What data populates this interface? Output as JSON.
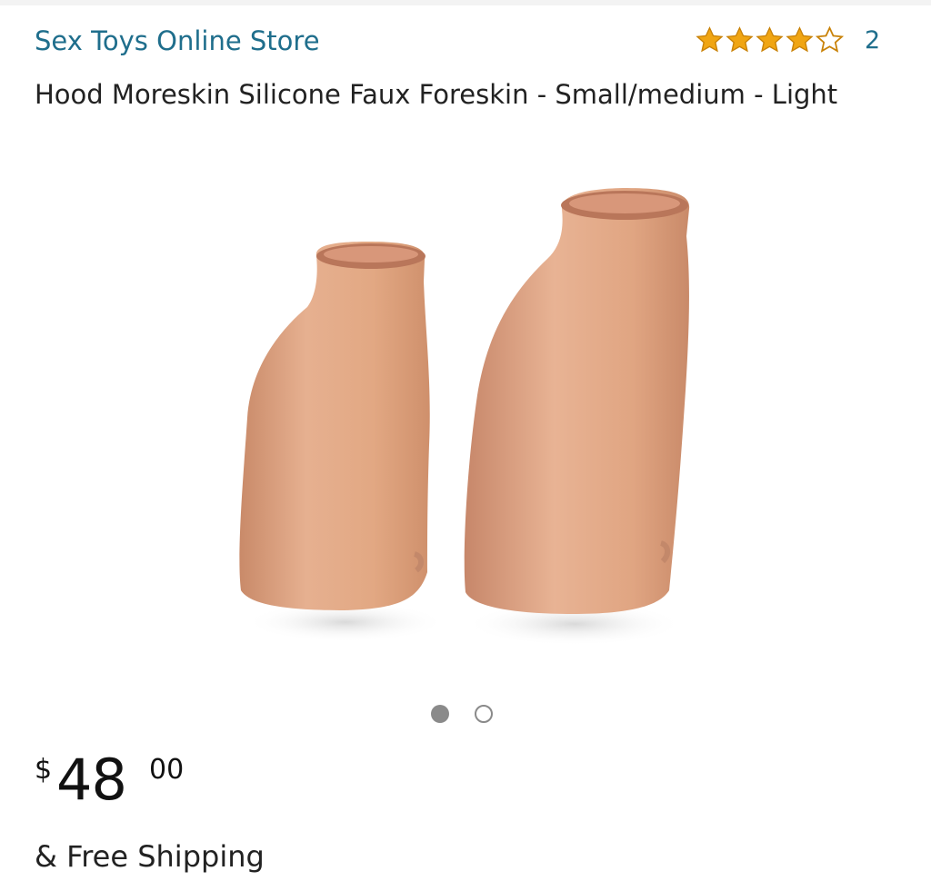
{
  "store": {
    "name": "Sex Toys Online Store"
  },
  "rating": {
    "stars": 4,
    "max": 5,
    "review_count": "2",
    "star_color": "#f0a513"
  },
  "product": {
    "title": "Hood Moreskin Silicone Faux Foreskin - Small/medium - Light",
    "image_icon": "product-photo",
    "carousel": {
      "count": 2,
      "active": 1
    }
  },
  "price": {
    "currency": "$",
    "whole": "48",
    "fraction": "00"
  },
  "shipping": {
    "text": "& Free Shipping"
  },
  "colors": {
    "link": "#1f6e8c",
    "skin": "#e2a883"
  }
}
